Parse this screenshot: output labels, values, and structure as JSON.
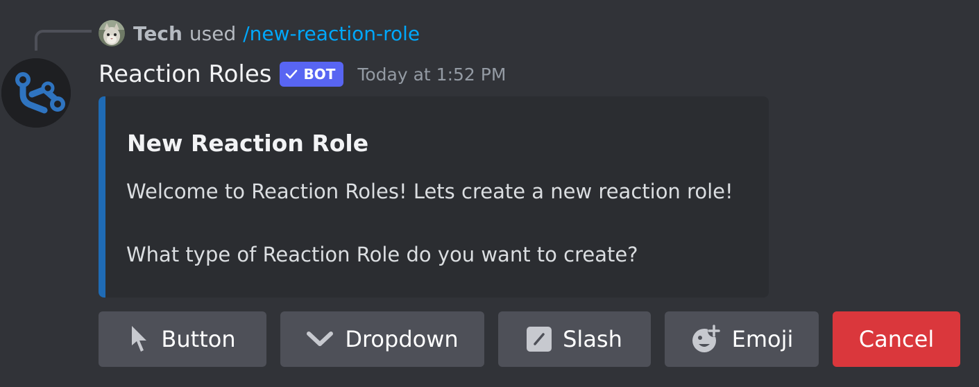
{
  "reply": {
    "user": "Tech",
    "used_text": "used",
    "command": "/new-reaction-role"
  },
  "message": {
    "author": "Reaction Roles",
    "bot_tag": "BOT",
    "timestamp": "Today at 1:52 PM"
  },
  "embed": {
    "accent_color": "#1f6bb5",
    "title": "New Reaction Role",
    "line1": "Welcome to Reaction Roles! Lets create a new reaction role!",
    "line2": "What type of Reaction Role do you want to create?"
  },
  "buttons": [
    {
      "label": "Button",
      "icon": "cursor-arrow-icon"
    },
    {
      "label": "Dropdown",
      "icon": "chevron-down-icon"
    },
    {
      "label": "Slash",
      "icon": "slash-command-icon"
    },
    {
      "label": "Emoji",
      "icon": "add-emoji-icon"
    },
    {
      "label": "Cancel",
      "style": "danger"
    }
  ],
  "colors": {
    "background": "#313338",
    "embed_bg": "#2b2d31",
    "link": "#00a8fc",
    "bot_tag": "#5865f2",
    "secondary_button": "#4e5058",
    "danger_button": "#da373c"
  }
}
